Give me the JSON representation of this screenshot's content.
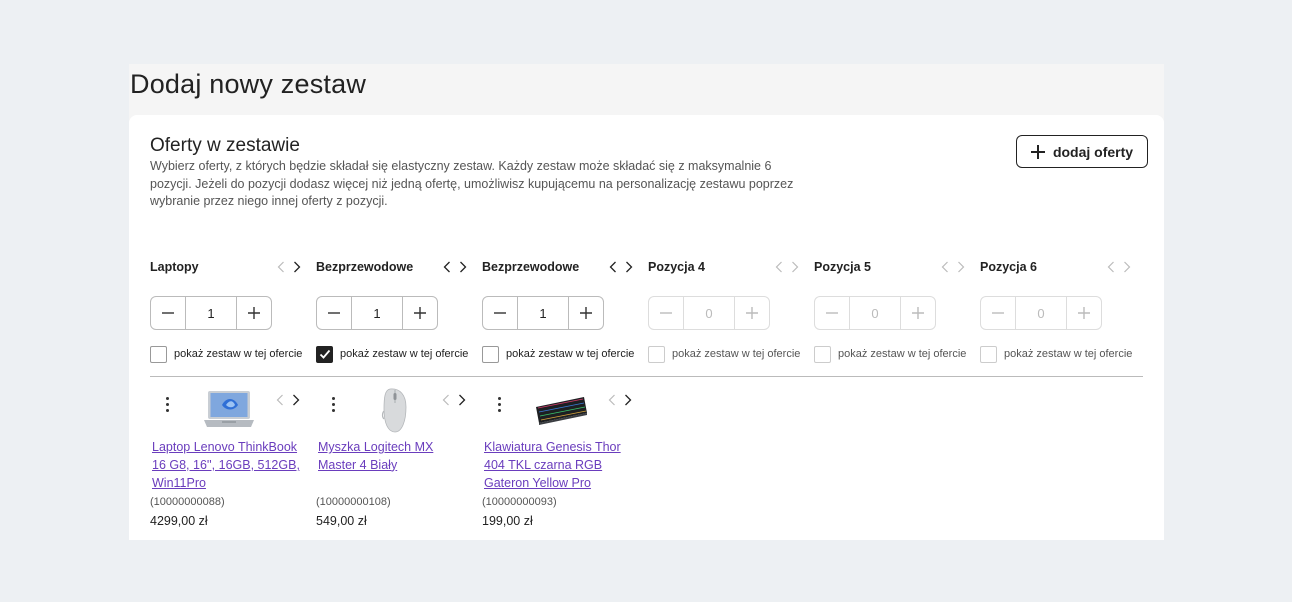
{
  "page": {
    "title": "Dodaj nowy zestaw"
  },
  "section": {
    "title": "Oferty w zestawie",
    "description": "Wybierz oferty, z których będzie składał się elastyczny zestaw. Każdy zestaw może składać się z maksymalnie 6 pozycji. Jeżeli do pozycji dodasz więcej niż jedną ofertę, umożliwisz kupującemu na personalizację zestawu poprzez wybranie przez niego innej oferty z pozycji.",
    "add_button_label": "dodaj oferty"
  },
  "show_label": "pokaż zestaw w tej ofercie",
  "positions": [
    {
      "name": "Laptopy",
      "quantity": "1",
      "show_checked": false,
      "enabled": true,
      "offer": {
        "title": "Laptop Lenovo ThinkBook 16 G8, 16'', 16GB, 512GB, Win11Pro",
        "id": "(10000000088)",
        "price": "4299,00 zł",
        "image_icon": "laptop-icon"
      }
    },
    {
      "name": "Bezprzewodowe",
      "quantity": "1",
      "show_checked": true,
      "enabled": true,
      "offer": {
        "title": "Myszka Logitech MX Master 4 Biały",
        "id": "(10000000108)",
        "price": "549,00 zł",
        "image_icon": "mouse-icon"
      }
    },
    {
      "name": "Bezprzewodowe",
      "quantity": "1",
      "show_checked": false,
      "enabled": true,
      "offer": {
        "title": "Klawiatura Genesis Thor 404 TKL czarna RGB Gateron Yellow Pro",
        "id": "(10000000093)",
        "price": "199,00 zł",
        "image_icon": "keyboard-icon"
      }
    },
    {
      "name": "Pozycja 4",
      "quantity": "0",
      "show_checked": false,
      "enabled": false
    },
    {
      "name": "Pozycja 5",
      "quantity": "0",
      "show_checked": false,
      "enabled": false
    },
    {
      "name": "Pozycja 6",
      "quantity": "0",
      "show_checked": false,
      "enabled": false
    }
  ],
  "colors": {
    "background": "#edf0f3",
    "card": "#ffffff",
    "link": "#6a3dbd",
    "text": "#222222",
    "disabled": "#bbbbbb"
  }
}
